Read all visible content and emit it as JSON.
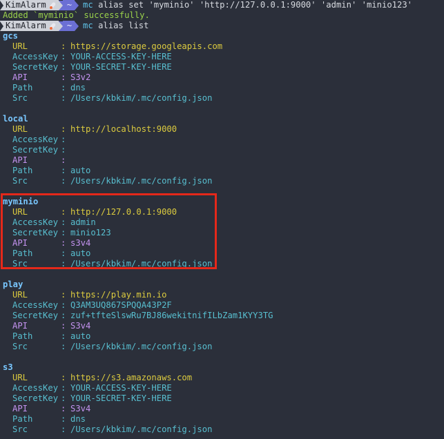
{
  "prompt": {
    "user": "KimAlarm",
    "dir": "~"
  },
  "commands": [
    {
      "name": "mc",
      "args": "alias set 'myminio' 'http://127.0.0.1:9000' 'admin' 'minio123'"
    },
    {
      "name": "mc",
      "args": "alias list"
    }
  ],
  "output_success": "Added `myminio` successfully.",
  "field_labels": {
    "url": "URL",
    "access": "AccessKey",
    "secret": "SecretKey",
    "api": "API",
    "path": "Path",
    "src": "Src"
  },
  "separator": ":",
  "aliases": [
    {
      "name": "gcs",
      "url": "https://storage.googleapis.com",
      "access": "YOUR-ACCESS-KEY-HERE",
      "secret": "YOUR-SECRET-KEY-HERE",
      "api": "S3v2",
      "path": "dns",
      "src": "/Users/kbkim/.mc/config.json"
    },
    {
      "name": "local",
      "url": "http://localhost:9000",
      "access": "",
      "secret": "",
      "api": "",
      "path": "auto",
      "src": "/Users/kbkim/.mc/config.json"
    },
    {
      "name": "myminio",
      "url": "http://127.0.0.1:9000",
      "access": "admin",
      "secret": "minio123",
      "api": "s3v4",
      "path": "auto",
      "src": "/Users/kbkim/.mc/config.json"
    },
    {
      "name": "play",
      "url": "https://play.min.io",
      "access": "Q3AM3UQ867SPQQA43P2F",
      "secret": "zuf+tfteSlswRu7BJ86wekitnifILbZam1KYY3TG",
      "api": "S3v4",
      "path": "auto",
      "src": "/Users/kbkim/.mc/config.json"
    },
    {
      "name": "s3",
      "url": "https://s3.amazonaws.com",
      "access": "YOUR-ACCESS-KEY-HERE",
      "secret": "YOUR-SECRET-KEY-HERE",
      "api": "S3v4",
      "path": "dns",
      "src": "/Users/kbkim/.mc/config.json"
    }
  ],
  "colors": {
    "background": "#2b2f3a",
    "highlight": "#e5281a",
    "url": "#dccb3f",
    "key": "#58bfd0",
    "api": "#c493f0",
    "alias": "#79c7ff",
    "success": "#9ad14b"
  }
}
